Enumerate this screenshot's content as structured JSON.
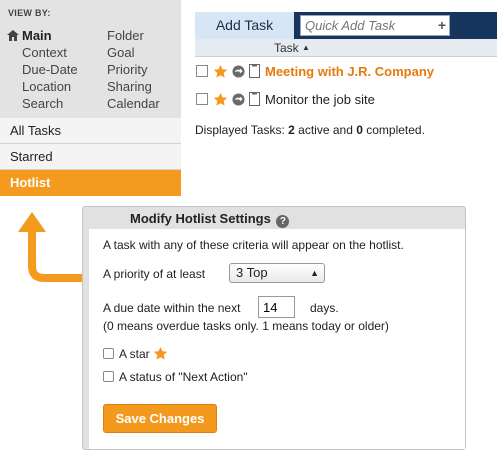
{
  "sidebar": {
    "viewby_heading": "VIEW BY:",
    "left_items": [
      "Main",
      "Context",
      "Due-Date",
      "Location",
      "Search"
    ],
    "right_items": [
      "Folder",
      "Goal",
      "Priority",
      "Sharing",
      "Calendar"
    ],
    "nav": [
      "All Tasks",
      "Starred",
      "Hotlist"
    ],
    "active_nav": "Hotlist"
  },
  "toolbar": {
    "add_task_label": "Add Task",
    "quick_add_placeholder": "Quick Add Task",
    "quick_add_plus": "+"
  },
  "table": {
    "column_header": "Task",
    "sort_indicator": "▲",
    "rows": [
      {
        "name": "Meeting with J.R. Company",
        "hot": true
      },
      {
        "name": "Monitor the job site",
        "hot": false
      }
    ]
  },
  "summary": {
    "prefix": "Displayed Tasks: ",
    "active_count": "2",
    "middle": " active and ",
    "completed_count": "0",
    "suffix": " completed."
  },
  "settings": {
    "title": "Modify Hotlist Settings",
    "help": "?",
    "intro": "A task with any of these criteria will appear on the hotlist.",
    "priority_label": "A priority of at least",
    "priority_value": "3 Top",
    "due_label": "A due date within the next",
    "due_value": "14",
    "due_suffix": "days.",
    "due_note": "(0 means overdue tasks only. 1 means today or older)",
    "star_label": "A star",
    "status_label": "A status of \"Next Action\"",
    "save_label": "Save Changes"
  },
  "colors": {
    "accent_orange": "#f49a1f",
    "navy": "#16355e",
    "hot_task": "#e67a0c"
  }
}
